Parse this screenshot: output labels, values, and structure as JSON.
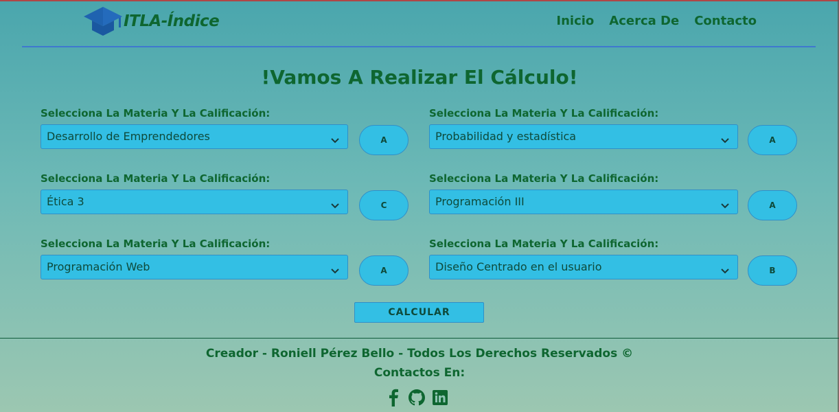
{
  "header": {
    "logo_text": "ITLA-Índice",
    "nav": [
      "Inicio",
      "Acerca De",
      "Contacto"
    ]
  },
  "main": {
    "title": "!Vamos A Realizar El Cálculo!",
    "field_label": "Selecciona La Materia Y La Calificación:",
    "fields": [
      {
        "subject": "Desarrollo de Emprendedores",
        "grade": "A"
      },
      {
        "subject": "Probabilidad y estadística",
        "grade": "A"
      },
      {
        "subject": "Ética 3",
        "grade": "C"
      },
      {
        "subject": "Programación III",
        "grade": "A"
      },
      {
        "subject": "Programación Web",
        "grade": "A"
      },
      {
        "subject": "Diseño Centrado en el usuario",
        "grade": "B"
      }
    ],
    "calc_label": "CALCULAR"
  },
  "footer": {
    "credits": "Creador - Roniell Pérez Bello - Todos Los Derechos Reservados ©",
    "contacts": "Contactos En:",
    "social_icons": [
      "facebook-icon",
      "github-icon",
      "linkedin-icon"
    ]
  },
  "colors": {
    "text_green": "#0e6630",
    "control_blue": "#33bfe4",
    "header_rule": "#3f78cf"
  }
}
